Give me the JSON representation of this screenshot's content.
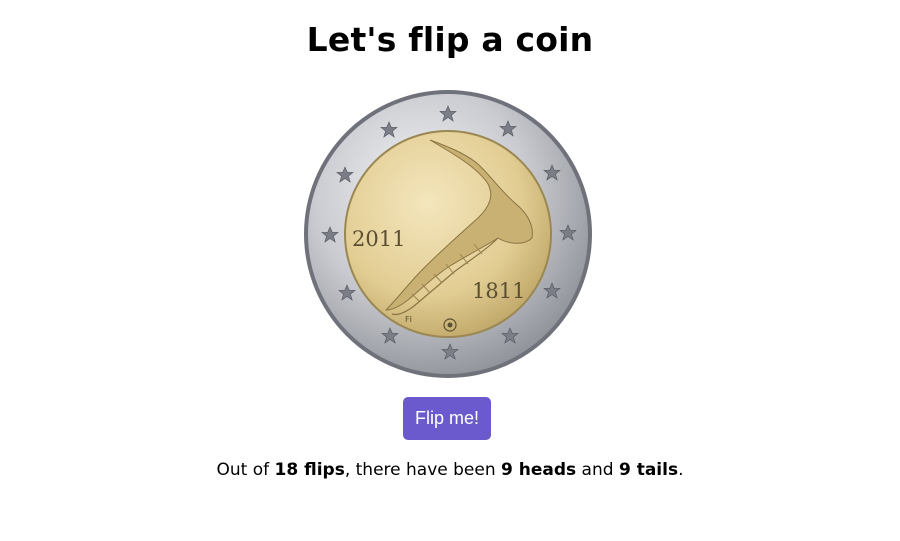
{
  "header": {
    "title": "Let's flip a coin"
  },
  "coin": {
    "image_name": "finnish-2-euro-coin",
    "year_left": "2011",
    "year_right": "1811",
    "mint_mark": "FI",
    "rim_color": "#c9cbd0",
    "center_color": "#e4d09a"
  },
  "controls": {
    "flip_label": "Flip me!",
    "button_color": "#6a5acd"
  },
  "summary": {
    "prefix": "Out of ",
    "flips_count": "18 flips",
    "middle1": ", there have been ",
    "heads_count": "9 heads",
    "middle2": " and ",
    "tails_count": "9 tails",
    "suffix": "."
  }
}
